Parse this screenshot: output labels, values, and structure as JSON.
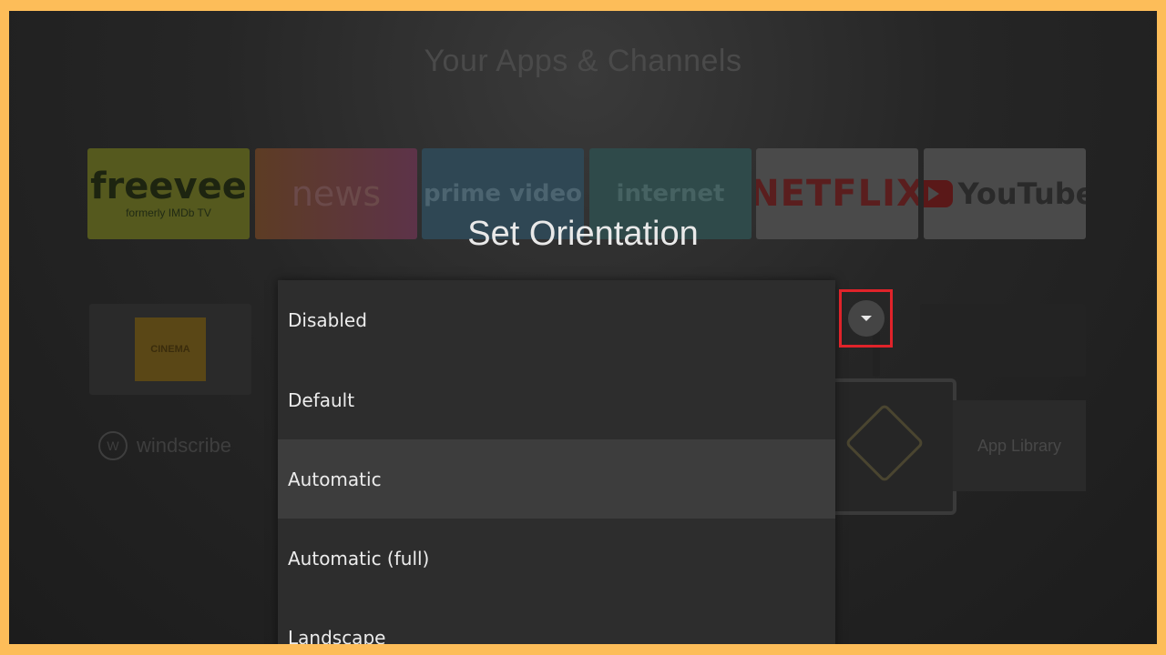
{
  "background": {
    "title": "Your Apps & Channels",
    "apps_row1": {
      "freevee": {
        "name": "freevee",
        "subtitle": "formerly IMDb TV"
      },
      "news": "news",
      "prime": "prime video",
      "internet": "internet",
      "netflix": "NETFLIX",
      "youtube": "YouTube"
    },
    "cinema_badge": "CINEMA",
    "windscribe": "windscribe",
    "app_library": "App Library"
  },
  "dialog": {
    "title": "Set Orientation",
    "options": [
      "Disabled",
      "Default",
      "Automatic",
      "Automatic (full)",
      "Landscape"
    ],
    "selected": "Automatic"
  },
  "colors": {
    "frame": "#FDBD59",
    "highlight": "#e0232a",
    "dropdown_bg": "#2d2d2d",
    "selected_bg": "#3d3d3d"
  },
  "icons": {
    "dropdown_arrow": "chevron-down-icon"
  }
}
